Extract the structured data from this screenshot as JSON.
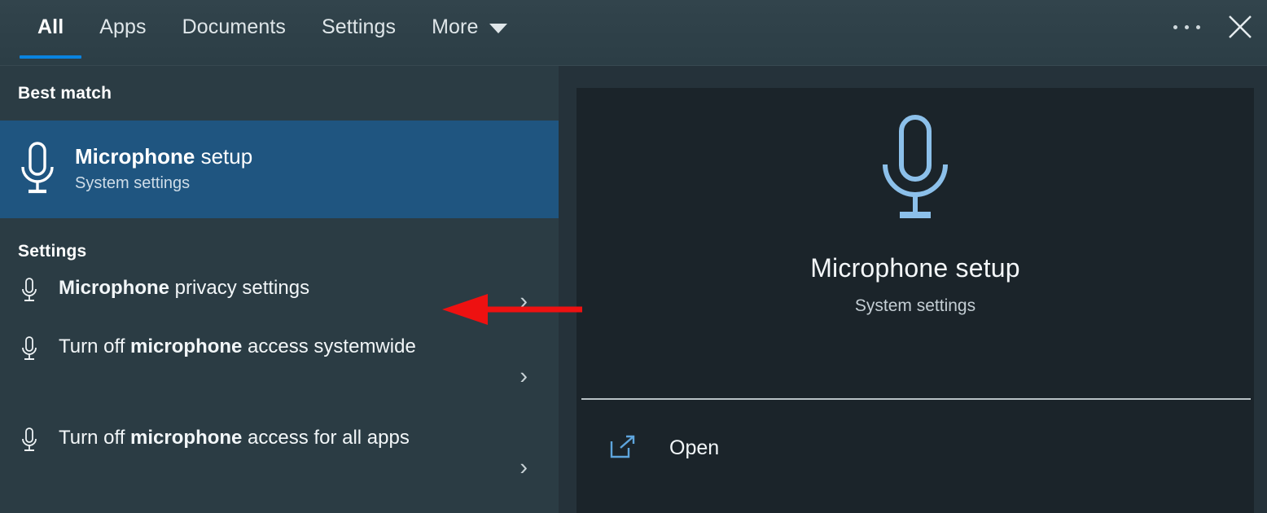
{
  "header": {
    "tabs": [
      {
        "label": "All",
        "active": true
      },
      {
        "label": "Apps",
        "active": false
      },
      {
        "label": "Documents",
        "active": false
      },
      {
        "label": "Settings",
        "active": false
      },
      {
        "label": "More",
        "active": false
      }
    ],
    "more_caret_icon": "chevron-down-icon",
    "overflow_icon": "ellipsis-icon",
    "close_icon": "close-icon"
  },
  "left": {
    "best_match_heading": "Best match",
    "best_match": {
      "icon": "microphone-icon",
      "title_bold": "Microphone",
      "title_rest": " setup",
      "subtitle": "System settings"
    },
    "settings_heading": "Settings",
    "settings_items": [
      {
        "icon": "microphone-icon",
        "pre": "",
        "bold": "Microphone",
        "post": " privacy settings",
        "chevron_icon": "chevron-right-icon",
        "lines": 1
      },
      {
        "icon": "microphone-icon",
        "pre": "Turn off ",
        "bold": "microphone",
        "post": " access systemwide",
        "chevron_icon": "chevron-right-icon",
        "lines": 2
      },
      {
        "icon": "microphone-icon",
        "pre": "Turn off ",
        "bold": "microphone",
        "post": " access for all apps",
        "chevron_icon": "chevron-right-icon",
        "lines": 2
      }
    ]
  },
  "preview": {
    "hero_icon": "microphone-icon",
    "title": "Microphone setup",
    "subtitle": "System settings",
    "actions": [
      {
        "icon": "open-external-icon",
        "label": "Open"
      }
    ]
  },
  "annotation": {
    "arrow_icon": "left-arrow-annotation",
    "color": "#ee1111"
  },
  "colors": {
    "header_bg": "#2e4048",
    "left_panel_bg": "#2b3c44",
    "right_panel_bg": "#25323a",
    "preview_card_bg": "#1b242a",
    "selection_blue": "#1f5580",
    "accent_blue": "#0a84e0",
    "icon_blue": "#8cc0ea",
    "text_primary": "#ffffff",
    "text_secondary": "#c4ced4"
  }
}
